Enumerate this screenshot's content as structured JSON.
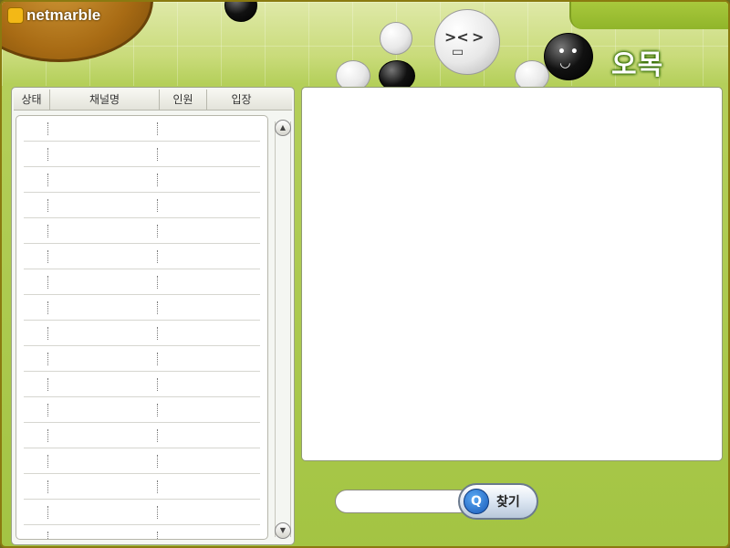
{
  "app": {
    "logo_text": "netmarble",
    "game_title": "오목"
  },
  "channel_list": {
    "columns": [
      "상태",
      "채널명",
      "인원",
      "입장"
    ],
    "row_count": 17
  },
  "search": {
    "value": "",
    "placeholder": "",
    "button_label": "찾기"
  },
  "icons": {
    "logo": "netmarble-logo-icon",
    "scroll_up": "scroll-up-arrow-icon",
    "scroll_down": "scroll-down-arrow-icon",
    "search": "magnifier-icon"
  },
  "colors": {
    "background_green": "#a3c443",
    "frame_border": "#8a7a10",
    "panel_bg": "#ffffff",
    "button_blue": "#1859b8"
  }
}
